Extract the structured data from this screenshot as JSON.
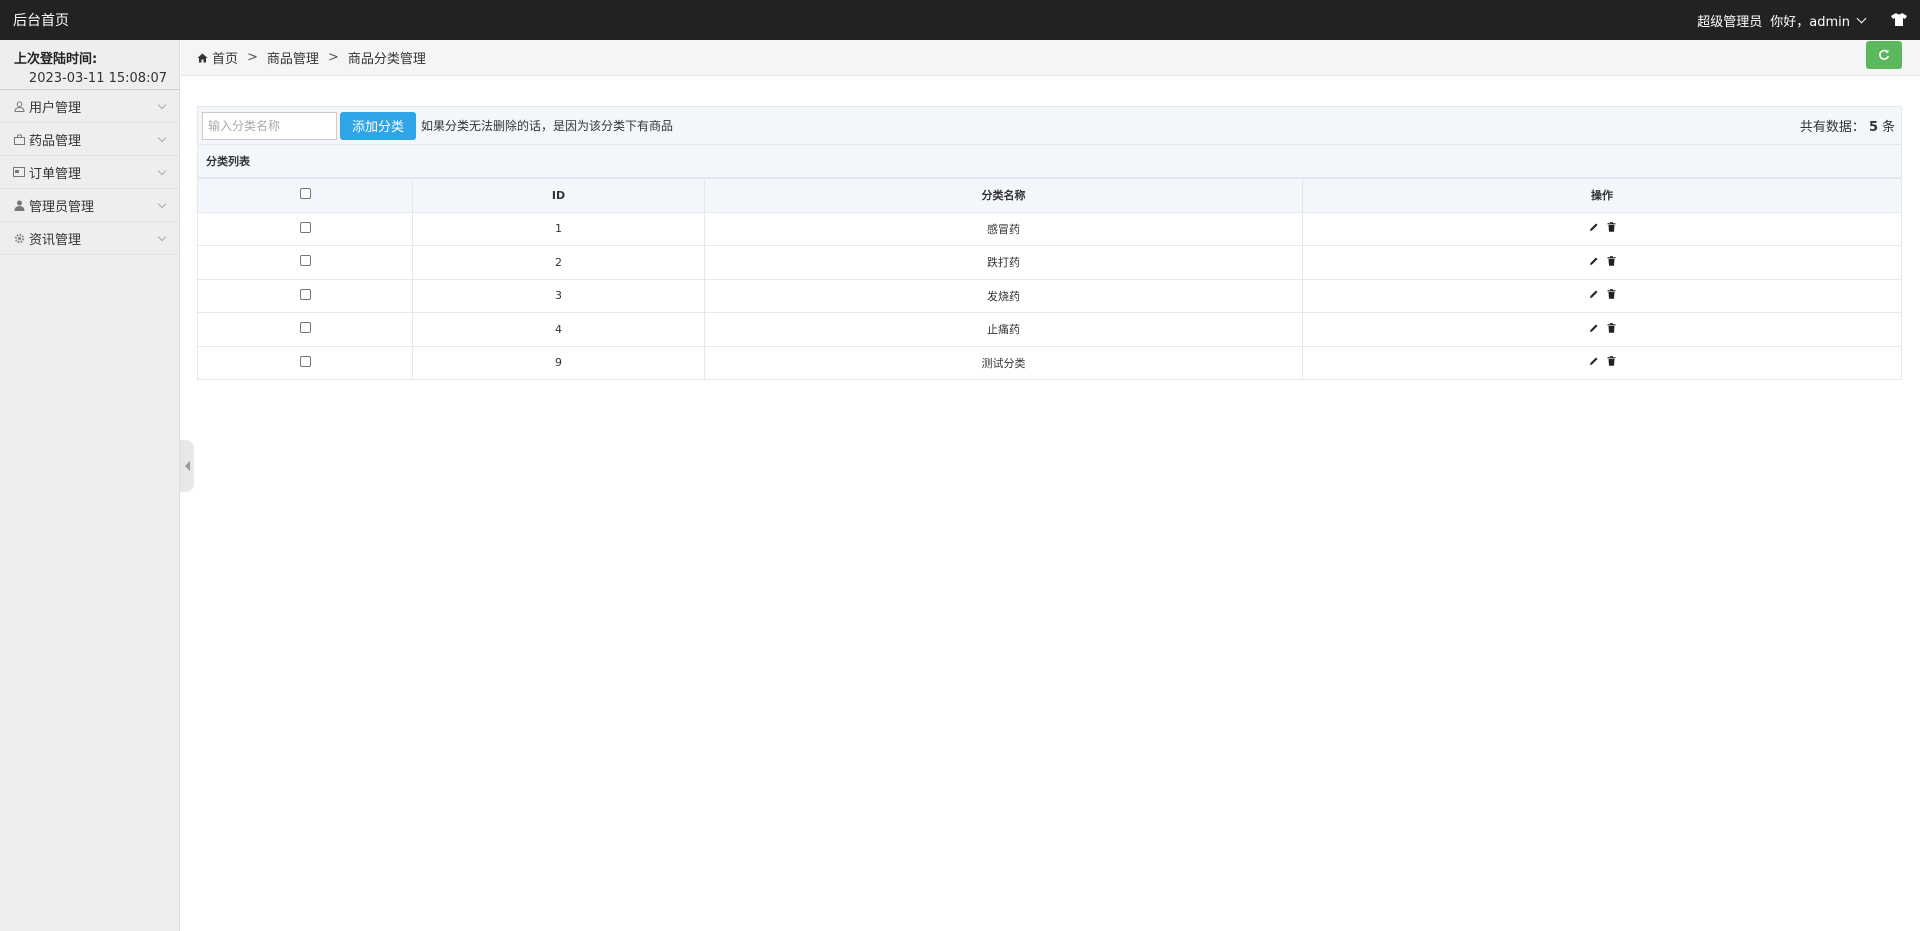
{
  "topbar": {
    "brand": "后台首页",
    "role": "超级管理员",
    "greeting": "你好，admin"
  },
  "sidebar": {
    "login_label": "上次登陆时间:",
    "login_time": "2023-03-11 15:08:07",
    "items": [
      {
        "label": "用户管理",
        "icon": "user-icon"
      },
      {
        "label": "药品管理",
        "icon": "bag-icon"
      },
      {
        "label": "订单管理",
        "icon": "card-icon"
      },
      {
        "label": "管理员管理",
        "icon": "admin-user-icon"
      },
      {
        "label": "资讯管理",
        "icon": "gear-icon"
      }
    ]
  },
  "breadcrumb": {
    "items": [
      "首页",
      "商品管理",
      "商品分类管理"
    ],
    "separator": ">"
  },
  "toolbar": {
    "search_placeholder": "输入分类名称",
    "add_label": "添加分类",
    "hint": "如果分类无法删除的话，是因为该分类下有商品",
    "total_prefix": "共有数据：",
    "total_count": "5",
    "total_suffix": "条"
  },
  "list": {
    "caption": "分类列表",
    "columns": [
      "",
      "ID",
      "分类名称",
      "操作"
    ],
    "rows": [
      {
        "id": "1",
        "name": "感冒药"
      },
      {
        "id": "2",
        "name": "跌打药"
      },
      {
        "id": "3",
        "name": "发烧药"
      },
      {
        "id": "4",
        "name": "止痛药"
      },
      {
        "id": "9",
        "name": "测试分类"
      }
    ]
  },
  "colors": {
    "topbar": "#222222",
    "sidebar": "#eeeeee",
    "add_button": "#2fa4e7",
    "refresh_button": "#5cb85c"
  }
}
